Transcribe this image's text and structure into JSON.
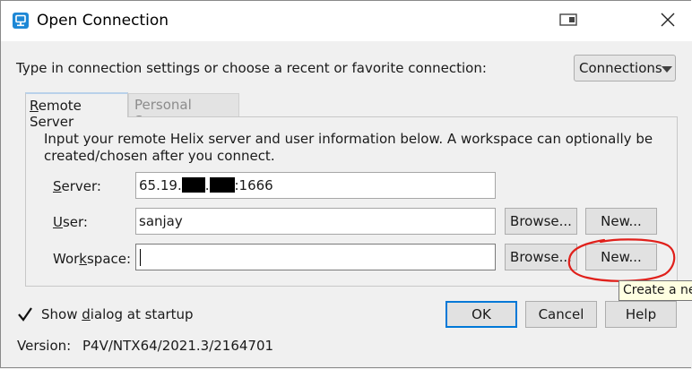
{
  "window": {
    "title": "Open Connection"
  },
  "instruction": "Type in connection settings or choose a recent or favorite connection:",
  "connections_button": {
    "label": "Connections"
  },
  "tabs": [
    {
      "label": "Remote Server",
      "active": true
    },
    {
      "label": "Personal Server",
      "active": false
    }
  ],
  "remote": {
    "info": "Input your remote Helix server and user information below. A workspace can optionally be created/chosen after you connect.",
    "server": {
      "label": "Server:",
      "value_prefix": "65.19.",
      "value_sep": ".",
      "value_suffix": ":1666"
    },
    "user": {
      "label": "User:",
      "value": "sanjay",
      "browse_label": "Browse...",
      "new_label": "New..."
    },
    "workspace": {
      "label": "Workspace:",
      "value": "",
      "browse_label": "Browse...",
      "new_label": "New..."
    }
  },
  "tooltip": {
    "text": "Create a ne"
  },
  "show_dialog": {
    "label": "Show dialog at startup",
    "checked": true
  },
  "buttons": {
    "ok": "OK",
    "cancel": "Cancel",
    "help": "Help"
  },
  "version": {
    "label": "Version:",
    "value": "P4V/NTX64/2021.3/2164701"
  },
  "colors": {
    "accent": "#0078d7",
    "annotation": "#e0201b",
    "tooltip_bg": "#ffffe1"
  },
  "icons": [
    "helix-app-icon",
    "restore-window-icon",
    "close-icon",
    "dropdown-caret-icon",
    "checkmark-icon"
  ]
}
